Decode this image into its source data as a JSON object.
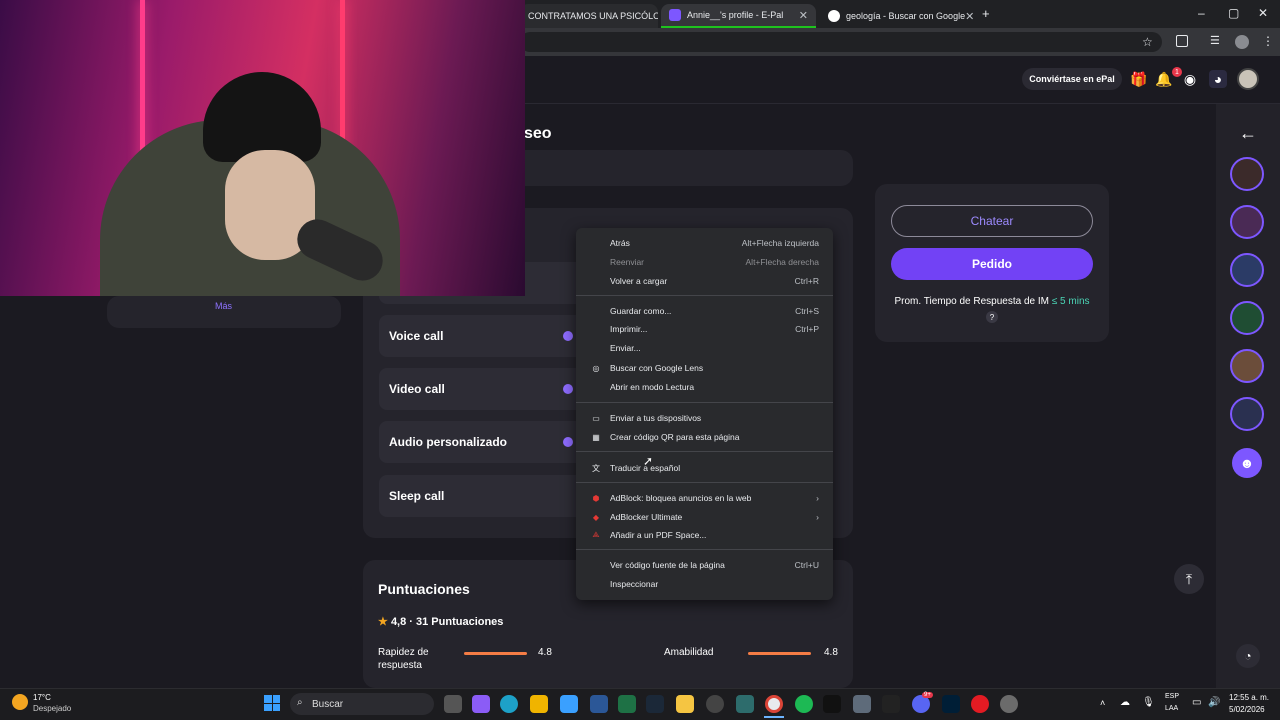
{
  "browser": {
    "tabs": [
      {
        "title": "CONTRATAMOS UNA PSICÓLOGA",
        "active": false
      },
      {
        "title": "Annie__'s profile - E-Pal",
        "active": true
      },
      {
        "title": "geología - Buscar con Google",
        "active": false
      }
    ],
    "new_tab": "+",
    "window_controls": [
      "–",
      "▢",
      "✕"
    ]
  },
  "header": {
    "cta": "Conviértase en ePal",
    "notification_badge": "1",
    "page_title_fragment": "seo"
  },
  "sidebar": {
    "more_label": "Más"
  },
  "services": [
    {
      "label": "Voice call"
    },
    {
      "label": "Video call"
    },
    {
      "label": "Audio personalizado"
    },
    {
      "label": "Sleep call"
    }
  ],
  "order_panel": {
    "chat_button": "Chatear",
    "order_button": "Pedido",
    "response_prefix": "Prom. Tiempo de Respuesta de IM",
    "response_value": "≤ 5 mins",
    "help": "?"
  },
  "ratings": {
    "title": "Puntuaciones",
    "summary": "4,8 · 31 Puntuaciones",
    "items": [
      {
        "label": "Rapidez de respuesta",
        "value": "4.8",
        "level": 0.96
      },
      {
        "label": "Amabilidad",
        "value": "4.8",
        "level": 0.96
      }
    ]
  },
  "context_menu": {
    "items": [
      {
        "label": "Atrás",
        "shortcut": "Alt+Flecha izquierda",
        "disabled": false
      },
      {
        "label": "Reenviar",
        "shortcut": "Alt+Flecha derecha",
        "disabled": true
      },
      {
        "label": "Volver a cargar",
        "shortcut": "Ctrl+R",
        "disabled": false
      },
      {
        "label": "Guardar como...",
        "shortcut": "Ctrl+S",
        "disabled": false
      },
      {
        "label": "Imprimir...",
        "shortcut": "Ctrl+P",
        "disabled": false
      },
      {
        "label": "Enviar...",
        "shortcut": "",
        "disabled": false
      },
      {
        "label": "Buscar con Google Lens",
        "shortcut": "",
        "disabled": false
      },
      {
        "label": "Abrir en modo Lectura",
        "shortcut": "",
        "disabled": false
      },
      {
        "label": "Enviar a tus dispositivos",
        "shortcut": "",
        "disabled": false
      },
      {
        "label": "Crear código QR para esta página",
        "shortcut": "",
        "disabled": false
      },
      {
        "label": "Traducir a español",
        "shortcut": "",
        "disabled": false
      },
      {
        "label": "AdBlock: bloquea anuncios en la web",
        "shortcut": "›",
        "disabled": false
      },
      {
        "label": "AdBlocker Ultimate",
        "shortcut": "›",
        "disabled": false
      },
      {
        "label": "Añadir a un PDF Space...",
        "shortcut": "",
        "disabled": false
      },
      {
        "label": "Ver código fuente de la página",
        "shortcut": "Ctrl+U",
        "disabled": false
      },
      {
        "label": "Inspeccionar",
        "shortcut": "",
        "disabled": false
      }
    ]
  },
  "taskbar": {
    "weather_temp": "17°C",
    "weather_desc": "Despejado",
    "search_placeholder": "Buscar",
    "lang_top": "ESP",
    "lang_bottom": "LAA",
    "time": "12:55 a. m.",
    "date": "5/02/2026",
    "discord_badge": "9+"
  },
  "colors": {
    "accent": "#7242f5",
    "highlight": "#4bd4b5",
    "rating_bar": "#f47c45"
  }
}
